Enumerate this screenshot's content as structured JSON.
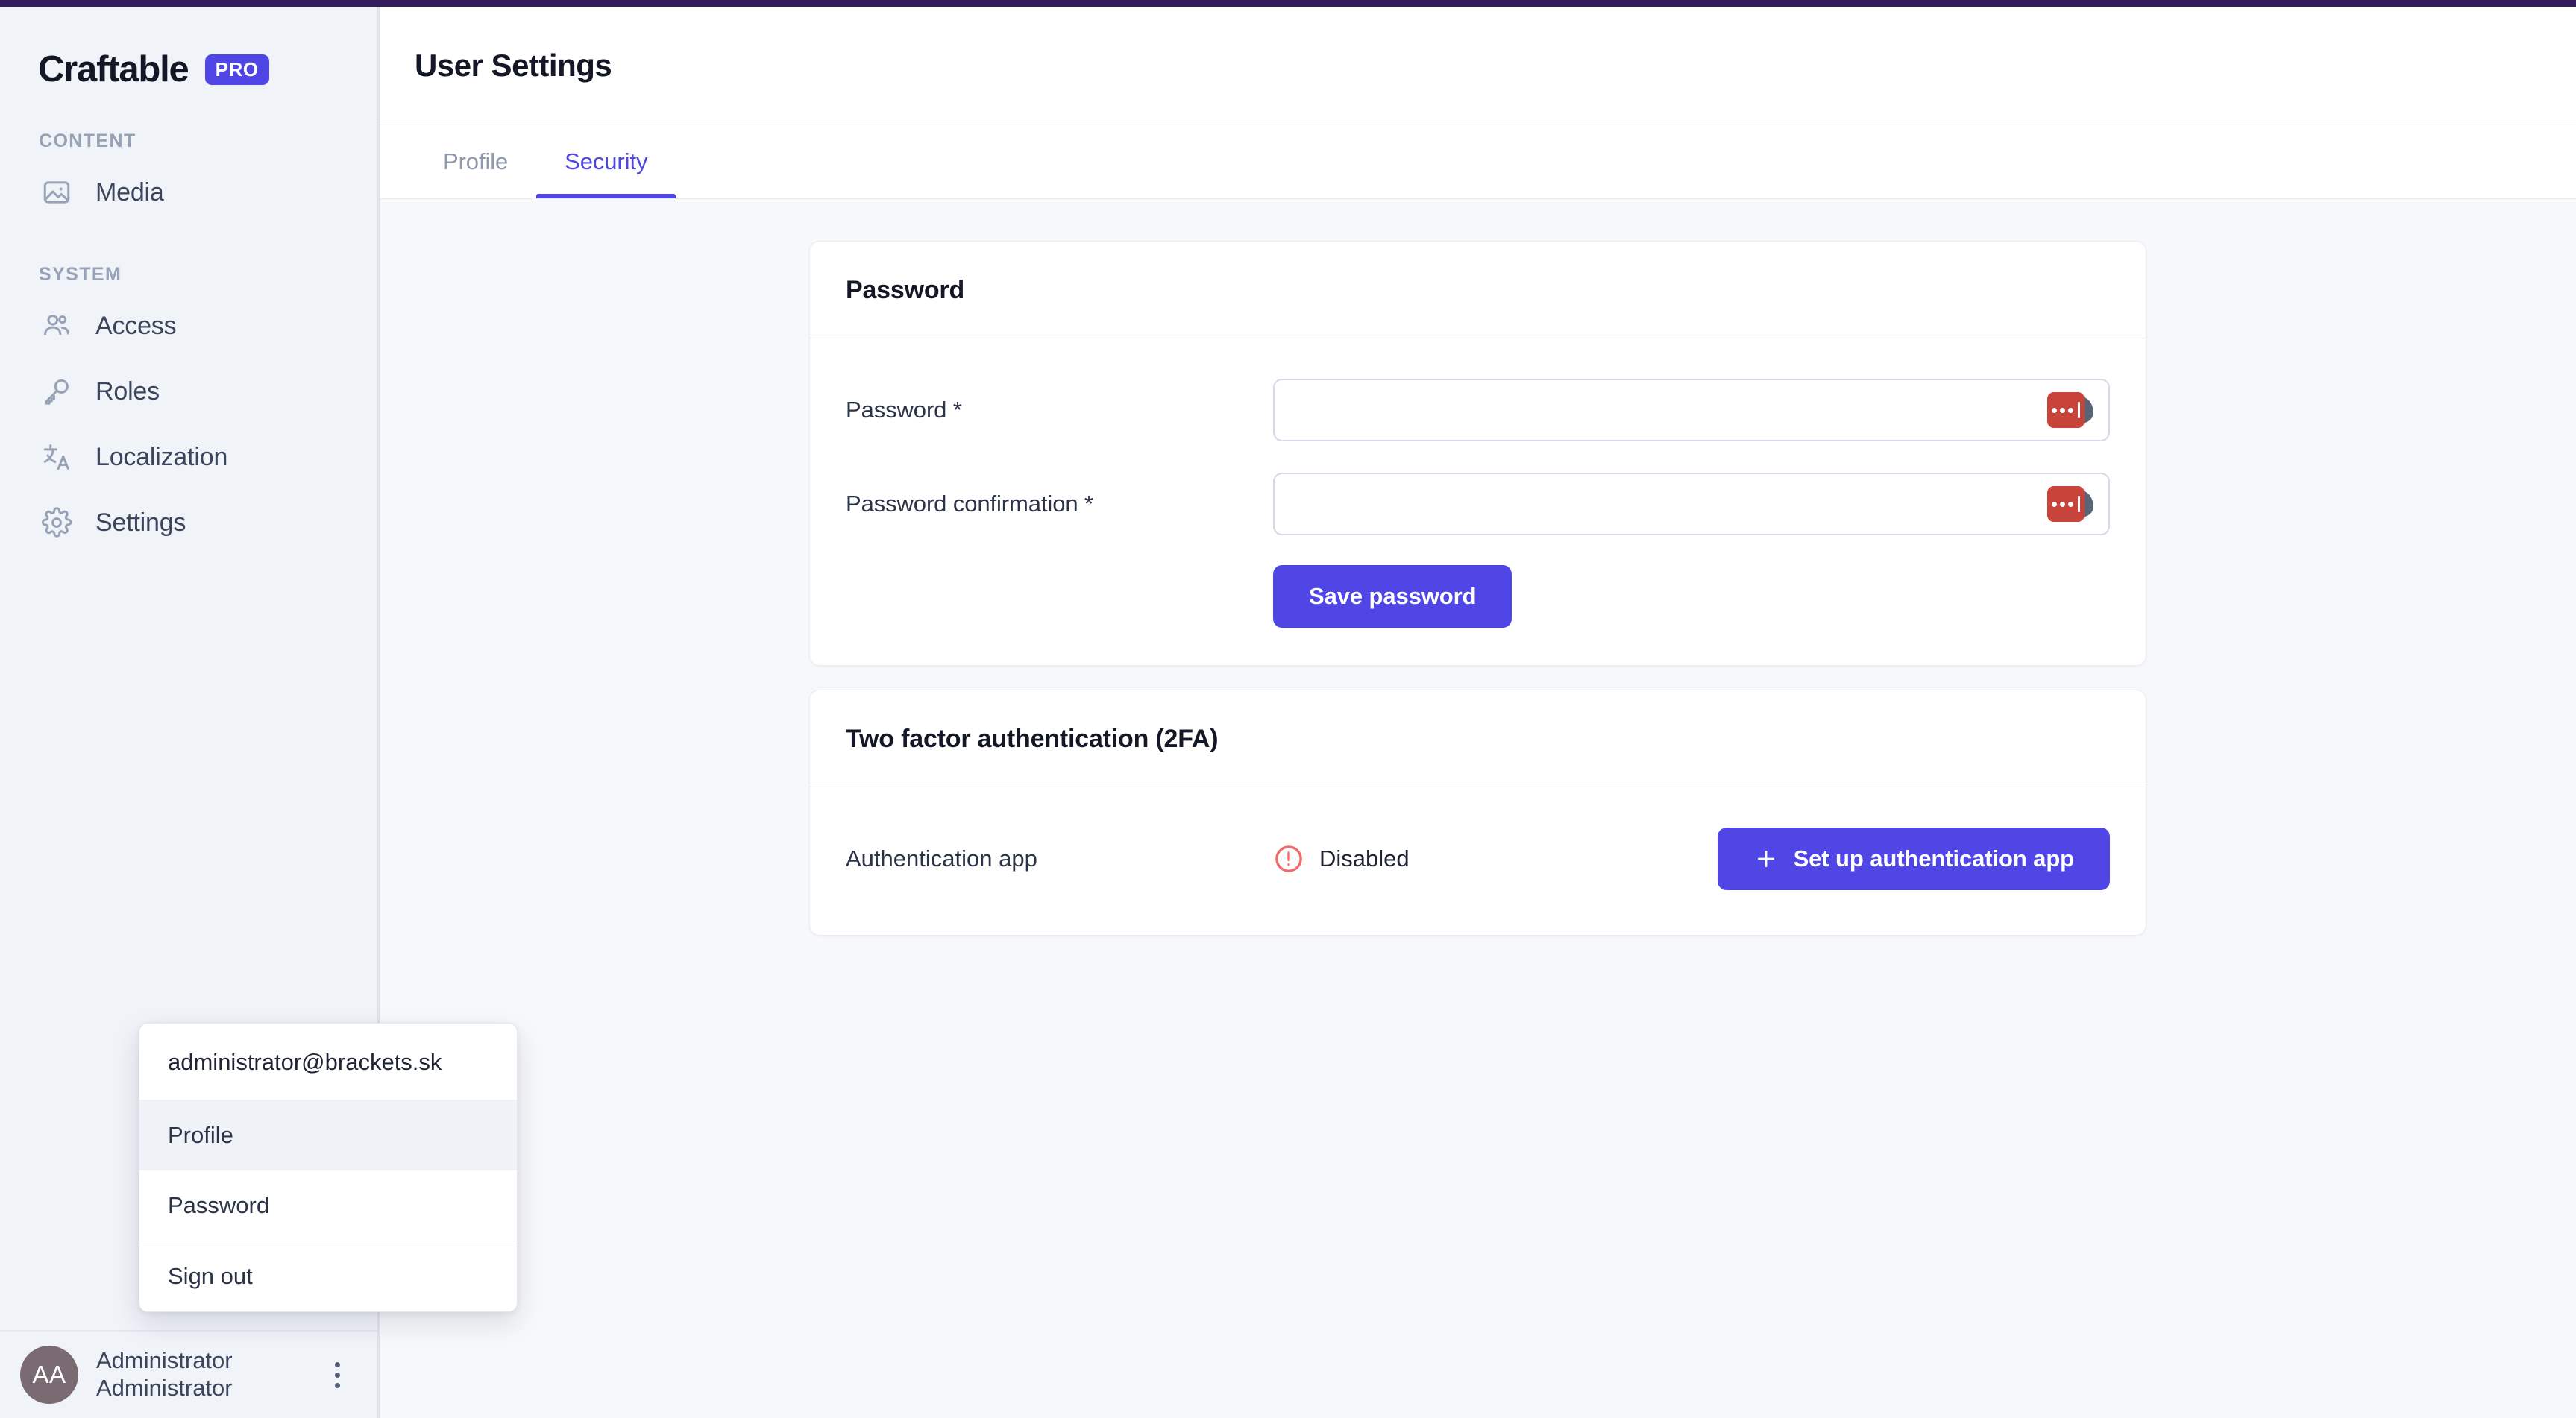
{
  "theme": {
    "accent": "#4f46e5",
    "top_strip": "#341b5c",
    "sidebar_bg": "#f0f3f8",
    "content_bg": "#f7f8fa",
    "danger": "#ef6b6b",
    "avatar_bg": "#7a6a72"
  },
  "sidebar": {
    "brand": {
      "name": "Craftable",
      "badge": "PRO"
    },
    "sections": [
      {
        "label": "CONTENT",
        "items": [
          {
            "label": "Media",
            "icon": "image-icon"
          }
        ]
      },
      {
        "label": "SYSTEM",
        "items": [
          {
            "label": "Access",
            "icon": "users-icon"
          },
          {
            "label": "Roles",
            "icon": "key-icon"
          },
          {
            "label": "Localization",
            "icon": "translate-icon"
          },
          {
            "label": "Settings",
            "icon": "gear-icon"
          }
        ]
      }
    ],
    "user": {
      "initials": "AA",
      "first_line": "Administrator",
      "second_line": "Administrator",
      "menu_icon": "kebab-icon"
    },
    "dropdown": {
      "email": "administrator@brackets.sk",
      "items": [
        {
          "label": "Profile",
          "active": true
        },
        {
          "label": "Password",
          "active": false
        },
        {
          "label": "Sign out",
          "active": false
        }
      ]
    }
  },
  "header": {
    "title": "User Settings"
  },
  "tabs": [
    {
      "label": "Profile",
      "active": false
    },
    {
      "label": "Security",
      "active": true
    }
  ],
  "password_card": {
    "title": "Password",
    "fields": [
      {
        "label": "Password *",
        "value": "",
        "placeholder": ""
      },
      {
        "label": "Password confirmation *",
        "value": "",
        "placeholder": ""
      }
    ],
    "save_label": "Save password",
    "field_badge_icon": "password-manager-icon"
  },
  "twofa_card": {
    "title": "Two factor authentication (2FA)",
    "row_label": "Authentication app",
    "status_text": "Disabled",
    "status_icon": "alert-circle-icon",
    "button_label": "Set up authentication app",
    "button_icon": "plus-icon"
  }
}
